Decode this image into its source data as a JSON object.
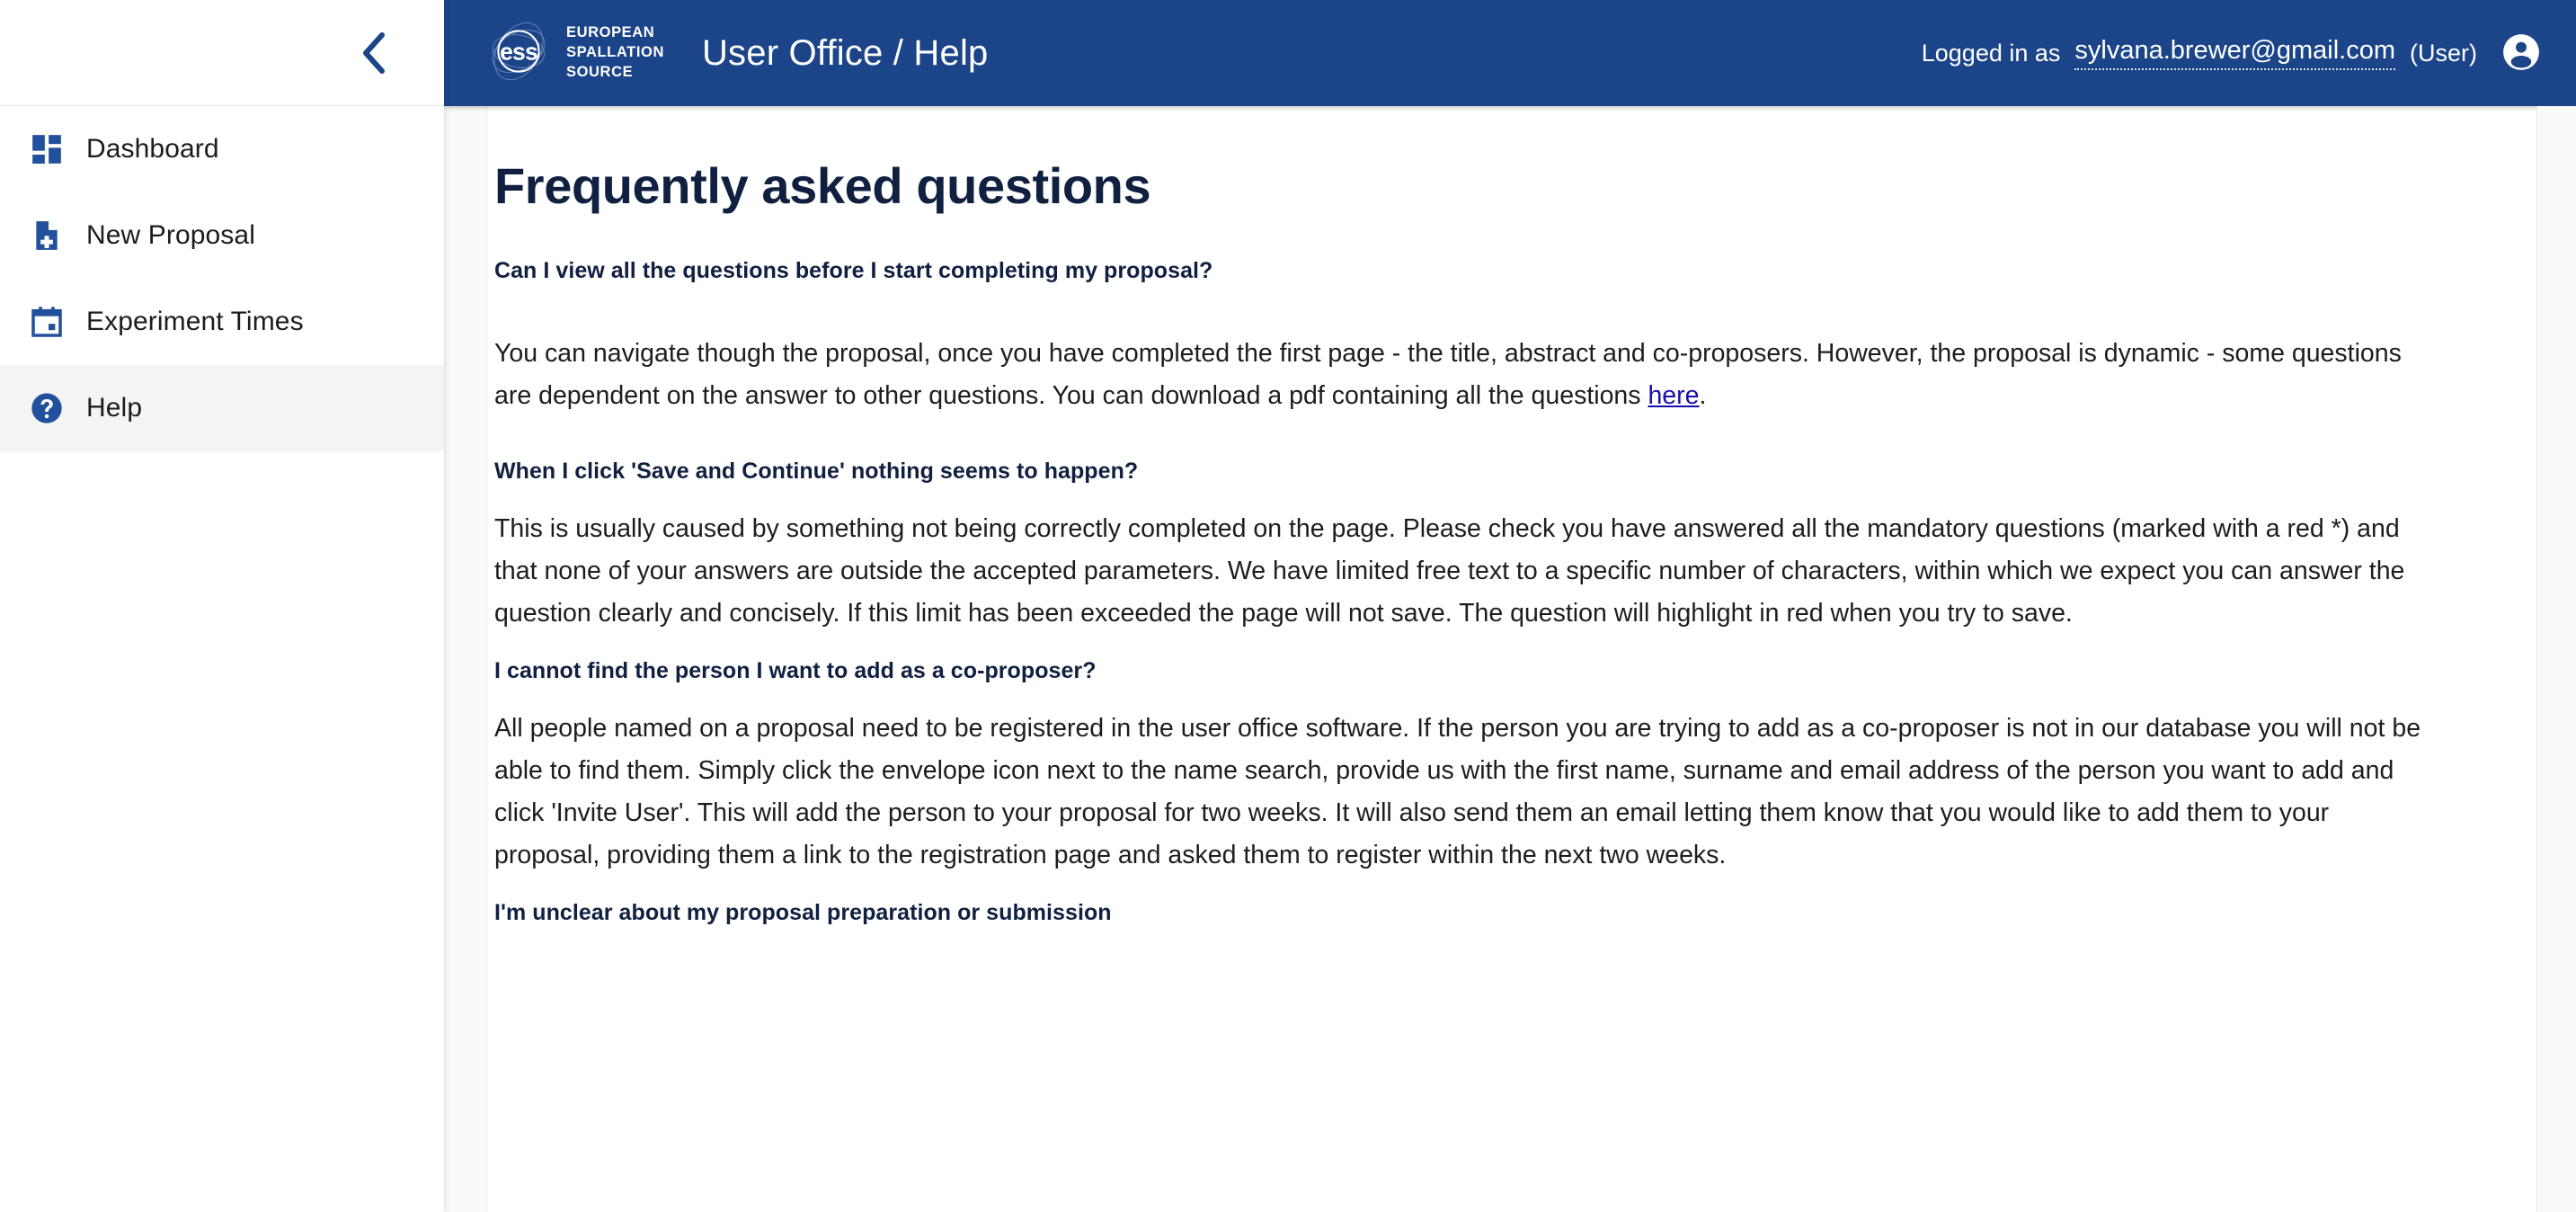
{
  "sidebar": {
    "collapse_icon": "chevron-left-icon",
    "items": [
      {
        "label": "Dashboard",
        "icon": "dashboard-icon",
        "active": false
      },
      {
        "label": "New Proposal",
        "icon": "note-add-icon",
        "active": false
      },
      {
        "label": "Experiment Times",
        "icon": "calendar-icon",
        "active": false
      },
      {
        "label": "Help",
        "icon": "help-circle-icon",
        "active": true
      }
    ]
  },
  "header": {
    "logo_alt": "ess",
    "logo_words": [
      "EUROPEAN",
      "SPALLATION",
      "SOURCE"
    ],
    "title": "User Office / Help",
    "logged_in_label": "Logged in as",
    "user_email": "sylvana.brewer@gmail.com",
    "user_role": "(User)",
    "avatar_icon": "account-circle-icon",
    "background_color": "#1b4489"
  },
  "main": {
    "page_title": "Frequently asked questions",
    "faq": [
      {
        "question": "Can I view all the questions before I start completing my proposal?",
        "answer_before_link": "You can navigate though the proposal, once you have completed the first page - the title, abstract and co-proposers. However, the proposal is dynamic - some questions are dependent on the answer to other questions. You can download a pdf containing all the questions ",
        "link_text": "here",
        "answer_after_link": "."
      },
      {
        "question": "When I click 'Save and Continue' nothing seems to happen?",
        "answer": "This is usually caused by something not being correctly completed on the page. Please check you have answered all the mandatory questions (marked with a red *) and that none of your answers are outside the accepted parameters. We have limited free text to a specific number of characters, within which we expect you can answer the question clearly and concisely. If this limit has been exceeded the page will not save. The question will highlight in red when you try to save."
      },
      {
        "question": "I cannot find the person I want to add as a co-proposer?",
        "answer": "All people named on a proposal need to be registered in the user office software. If the person you are trying to add as a co-proposer is not in our database you will not be able to find them. Simply click the envelope icon next to the name search, provide us with the first name, surname and email address of the person you want to add and click 'Invite User'. This will add the person to your proposal for two weeks. It will also send them an email letting them know that you would like to add them to your proposal, providing them a link to the registration page and asked them to register within the next two weeks."
      },
      {
        "question": "I'm unclear about my proposal preparation or submission",
        "answer": ""
      }
    ]
  },
  "colors": {
    "brand_blue": "#1b4489",
    "icon_blue": "#21509d",
    "heading_navy": "#102040",
    "link_blue": "#1a0dab"
  }
}
